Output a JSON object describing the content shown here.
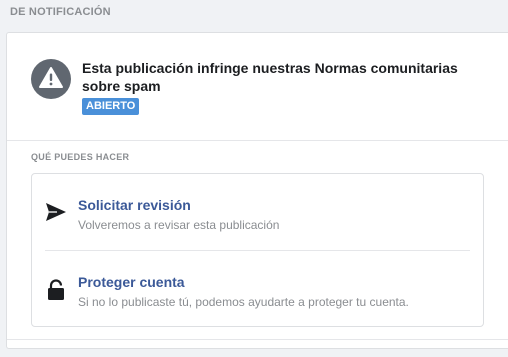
{
  "header": {
    "section_title": "DE NOTIFICACIÓN"
  },
  "alert": {
    "icon": "warning-icon",
    "title": "Esta publicación infringe nuestras Normas comunitarias sobre spam",
    "status": "ABIERTO",
    "status_color": "#4a90d9"
  },
  "actions": {
    "heading": "QUÉ PUEDES HACER",
    "items": [
      {
        "icon": "send-icon",
        "title": "Solicitar revisión",
        "description": "Volveremos a revisar esta publicación"
      },
      {
        "icon": "lock-icon",
        "title": "Proteger cuenta",
        "description": "Si no lo publicaste tú, podemos ayudarte a proteger tu cuenta."
      }
    ]
  },
  "colors": {
    "link": "#3b5998",
    "muted": "#8a8d91",
    "icon": "#606770",
    "background": "#f0f2f5"
  }
}
